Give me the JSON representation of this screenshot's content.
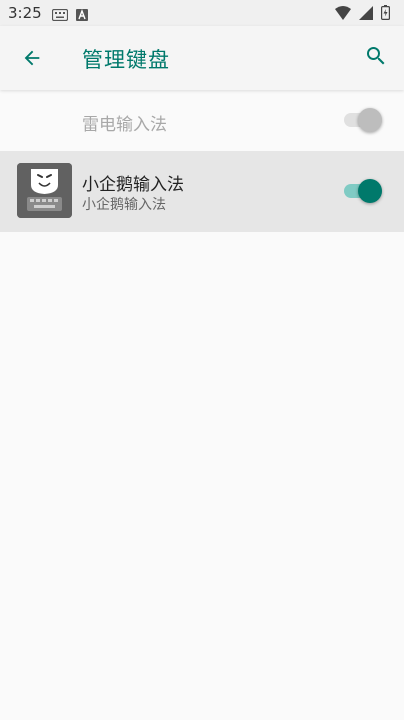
{
  "status_bar": {
    "time": "3:25"
  },
  "app_bar": {
    "title": "管理键盘"
  },
  "keyboards": [
    {
      "title": "雷电输入法",
      "enabled": false,
      "disabled": true
    },
    {
      "title": "小企鹅输入法",
      "subtitle": "小企鹅输入法",
      "enabled": true
    }
  ],
  "colors": {
    "accent": "#00796b",
    "accent_light": "#80cbc4",
    "selected_row": "#e6e6e6"
  }
}
